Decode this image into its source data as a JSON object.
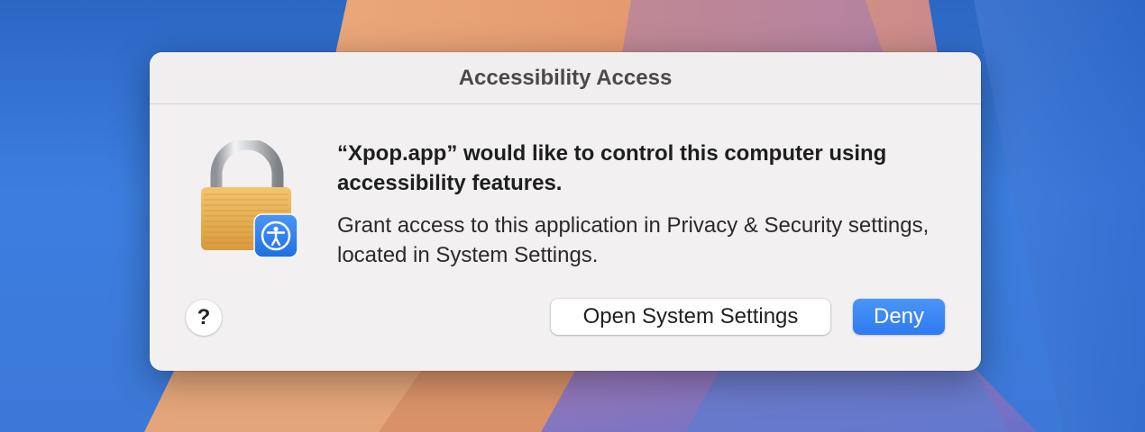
{
  "dialog": {
    "title": "Accessibility Access",
    "heading": "“Xpop.app” would like to control this computer using accessibility features.",
    "body": "Grant access to this application in Privacy & Security settings, located in System Settings.",
    "icon": "lock-with-accessibility-badge-icon",
    "help_label": "?",
    "buttons": {
      "open_settings": "Open System Settings",
      "deny": "Deny"
    },
    "accent_color": "#3580f3"
  }
}
